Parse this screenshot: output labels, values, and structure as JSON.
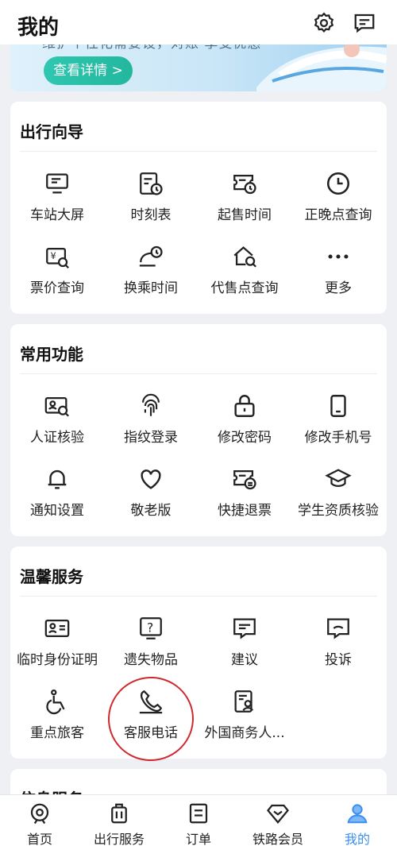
{
  "header": {
    "title": "我的",
    "settings_icon": "gear-icon",
    "message_icon": "message-icon"
  },
  "banner": {
    "text": "维护个性化需要设，对账·享受优惠",
    "button": "查看详情 >"
  },
  "sections": [
    {
      "title": "出行向导",
      "items": [
        {
          "label": "车站大屏",
          "icon": "monitor-icon"
        },
        {
          "label": "时刻表",
          "icon": "timetable-icon"
        },
        {
          "label": "起售时间",
          "icon": "sale-time-icon"
        },
        {
          "label": "正晚点查询",
          "icon": "clock-icon"
        },
        {
          "label": "票价查询",
          "icon": "ticket-price-icon"
        },
        {
          "label": "换乘时间",
          "icon": "transfer-time-icon"
        },
        {
          "label": "代售点查询",
          "icon": "agency-search-icon"
        },
        {
          "label": "更多",
          "icon": "more-icon"
        }
      ]
    },
    {
      "title": "常用功能",
      "items": [
        {
          "label": "人证核验",
          "icon": "id-verify-icon"
        },
        {
          "label": "指纹登录",
          "icon": "fingerprint-icon"
        },
        {
          "label": "修改密码",
          "icon": "lock-icon"
        },
        {
          "label": "修改手机号",
          "icon": "phone-icon"
        },
        {
          "label": "通知设置",
          "icon": "bell-icon"
        },
        {
          "label": "敬老版",
          "icon": "heart-icon"
        },
        {
          "label": "快捷退票",
          "icon": "refund-icon"
        },
        {
          "label": "学生资质核验",
          "icon": "graduation-cap-icon"
        }
      ]
    },
    {
      "title": "温馨服务",
      "items": [
        {
          "label": "临时身份证明",
          "icon": "temp-id-icon"
        },
        {
          "label": "遗失物品",
          "icon": "lost-item-icon"
        },
        {
          "label": "建议",
          "icon": "suggestion-icon"
        },
        {
          "label": "投诉",
          "icon": "complaint-icon"
        },
        {
          "label": "重点旅客",
          "icon": "wheelchair-icon"
        },
        {
          "label": "客服电话",
          "icon": "telephone-icon"
        },
        {
          "label": "外国商务人...",
          "icon": "foreign-business-icon"
        }
      ]
    },
    {
      "title": "信息服务"
    }
  ],
  "tabbar": [
    {
      "label": "首页",
      "icon": "home-icon"
    },
    {
      "label": "出行服务",
      "icon": "luggage-icon"
    },
    {
      "label": "订单",
      "icon": "order-icon"
    },
    {
      "label": "铁路会员",
      "icon": "diamond-icon"
    },
    {
      "label": "我的",
      "icon": "user-icon",
      "active": true
    }
  ],
  "colors": {
    "accent": "#3b8ff0",
    "banner_button": "#23b79e",
    "annotation": "#d0282e"
  }
}
